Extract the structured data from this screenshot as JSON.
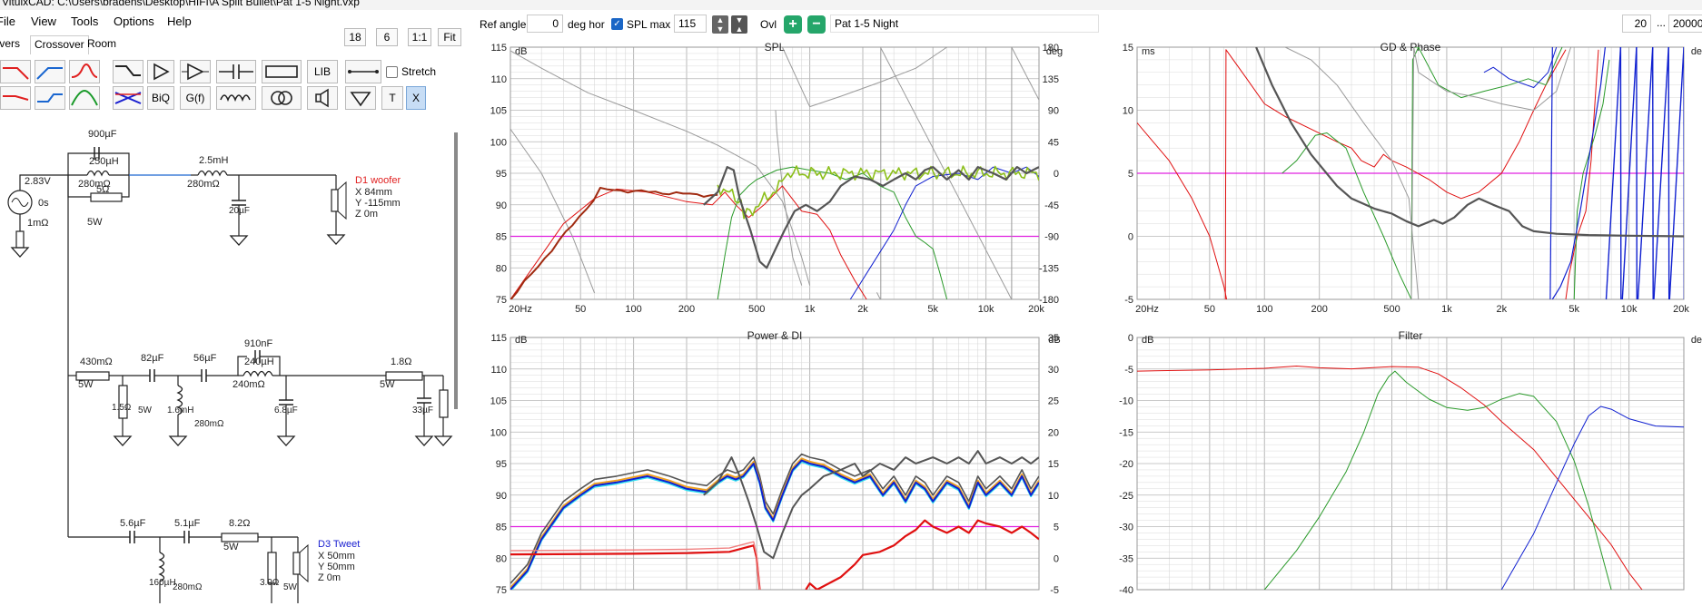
{
  "window": {
    "title": "VituixCAD: C:\\Users\\bradens\\Desktop\\HIFI\\A Split Bullet\\Pat 1-5 Night.vxp"
  },
  "menu": [
    "File",
    "View",
    "Tools",
    "Options",
    "Help"
  ],
  "tabs": [
    "Drivers",
    "Crossover",
    "Room"
  ],
  "zoom_buttons": {
    "a": "18",
    "b": "6",
    "c": "1:1",
    "d": "Fit"
  },
  "toolbar": {
    "lib": "LIB",
    "biq": "BiQ",
    "gf": "G(f)",
    "t": "T",
    "x": "X",
    "stretch": "Stretch"
  },
  "topbar": {
    "ref_angle_label": "Ref angle",
    "ref_angle_value": "0",
    "deg_hor": "deg hor",
    "spl_max_label": "SPL max",
    "spl_max_value": "115",
    "ovl": "Ovl",
    "overlay_name": "Pat 1-5 Night",
    "freq_min": "20",
    "dots": "...",
    "freq_max": "20000"
  },
  "schematic": {
    "source_voltage": "2.83V",
    "source_delay": "0s",
    "source_r": "1mΩ",
    "c_900": "900µF",
    "l_250": "250µH",
    "r_280a": "280mΩ",
    "r_5": "5Ω",
    "r_5w_a": "5W",
    "l_2_5": "2.5mH",
    "r_280b": "280mΩ",
    "c_20": "20µF",
    "d1_name": "D1 woofer",
    "d1_x": "X 84mm",
    "d1_y": "Y -115mm",
    "d1_z": "Z 0m",
    "r_430": "430mΩ",
    "r_5w_b": "5W",
    "r_1_5": "1.5Ω",
    "r_5w_c": "5W",
    "c_82": "82µF",
    "l_1_6": "1.6mH",
    "r_280c": "280mΩ",
    "c_56": "56µF",
    "c_910": "910nF",
    "l_240": "240µH",
    "r_240": "240mΩ",
    "c_6_8": "6.8µF",
    "r_1_8": "1.8Ω",
    "r_5w_d": "5W",
    "c_33": "33µF",
    "c_5_6": "5.6µF",
    "c_5_1": "5.1µF",
    "r_8_2": "8.2Ω",
    "r_5w_e": "5W",
    "l_160": "160µH",
    "r_280d": "280mΩ",
    "r_3_9": "3.9Ω",
    "r_5w_f": "5W",
    "d3_name": "D3 Tweet",
    "d3_x": "X 50mm",
    "d3_y": "Y 50mm",
    "d3_z": "Z 0m"
  },
  "panels": {
    "spl": {
      "title": "SPL",
      "left_unit": "dB",
      "right_unit": "deg"
    },
    "gd": {
      "title": "GD & Phase",
      "left_unit": "ms",
      "right_unit": "deg"
    },
    "power": {
      "title": "Power & DI",
      "left_unit": "dB",
      "right_unit": "dB"
    },
    "filter": {
      "title": "Filter",
      "left_unit": "dB",
      "right_unit": "deg"
    }
  },
  "axes": {
    "freq_ticks": [
      "20Hz",
      "50",
      "100",
      "200",
      "500",
      "1k",
      "2k",
      "5k",
      "10k",
      "20k"
    ],
    "spl_left": [
      "115",
      "110",
      "105",
      "100",
      "95",
      "90",
      "85",
      "80",
      "75"
    ],
    "spl_right": [
      "180",
      "135",
      "90",
      "45",
      "0",
      "-45",
      "-90",
      "-135",
      "-180"
    ],
    "gd_left": [
      "15",
      "10",
      "5",
      "0",
      "-5"
    ],
    "power_left": [
      "115",
      "110",
      "105",
      "100",
      "95",
      "90",
      "85",
      "80",
      "75"
    ],
    "power_right": [
      "35",
      "30",
      "25",
      "20",
      "15",
      "10",
      "5",
      "0",
      "-5"
    ],
    "filter_left": [
      "0",
      "-5",
      "-10",
      "-15",
      "-20",
      "-25",
      "-30",
      "-35",
      "-40"
    ]
  },
  "colors": {
    "grid": "#d9d9d9",
    "grid_major": "#b8b8b8",
    "magenta": "#e020e0",
    "red": "#e01010",
    "green": "#2a9a2a",
    "blue": "#1020d0",
    "gray": "#555555",
    "lightgray": "#9a9a9a",
    "olive": "#8cbf1a",
    "darkred": "#a02a10",
    "cyan": "#30e0f0",
    "orange": "#f0a020",
    "accent": "#1a66c6"
  }
}
